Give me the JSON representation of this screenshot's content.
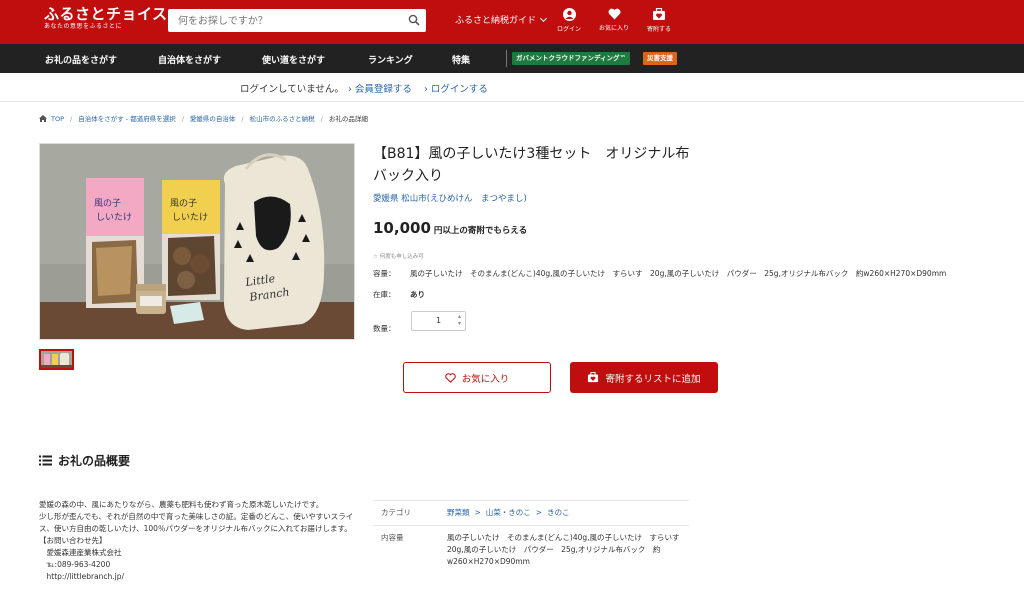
{
  "header": {
    "logo_main": "ふるさとチョイス",
    "logo_sub": "あなたの意思をふるさとに",
    "search_placeholder": "何をお探しですか？",
    "guide_label": "ふるさと納税ガイド",
    "icons": [
      {
        "icon": "user-icon",
        "label": "ログイン"
      },
      {
        "icon": "heart-icon",
        "label": "お気に入り"
      },
      {
        "icon": "donation-list-icon",
        "label": "寄附する"
      }
    ],
    "brand_color": "#c00d0d"
  },
  "nav": {
    "items": [
      "お礼の品をさがす",
      "自治体をさがす",
      "使い道をさがす",
      "ランキング",
      "特集"
    ],
    "badge_gcf": "ガバメントクラウドファンディング™",
    "badge_disaster": "災害支援",
    "badge_gcf_color": "#1e7a3e",
    "badge_disaster_color": "#e0631a"
  },
  "loginbar": {
    "message": "ログインしていません。",
    "register": "会員登録する",
    "login": "ログインする"
  },
  "breadcrumb": [
    "TOP",
    "自治体をさがす - 都道府県を選択",
    "愛媛県の自治体",
    "松山市のふるさと納税",
    "お礼の品詳細"
  ],
  "product": {
    "title": "【B81】風の子しいたけ3種セット　オリジナル布バック入り",
    "place": "愛媛県 松山市(えひめけん　まつやまし)",
    "price_number": "10,000",
    "price_unit": "円以上の寄附でもらえる",
    "anytime": "何度も申し込み可",
    "capacity_label": "容量：",
    "capacity_value": "風の子しいたけ　そのまんま(どんこ)40g,風の子しいたけ　すらいす　20g,風の子しいたけ　パウダー　25g,オリジナル布バック　約w260×H270×D90mm",
    "stock_label": "在庫：",
    "stock_value": "あり",
    "qty_label": "数量：",
    "qty_value": "1",
    "favorite_button": "お気に入り",
    "add_button": "寄附するリストに追加",
    "image_labels": {
      "bag_word": "Little Branch",
      "pack1": "風の子しいたけ",
      "pack2": "風の子しいたけ"
    }
  },
  "overview": {
    "heading": "お礼の品概要",
    "description": [
      "愛媛の森の中、風にあたりながら、農薬も肥料も使わず育った原木乾しいたけです。",
      "少し形が歪んでも、それが自然の中で育った美味しさの証。定番のどんこ、使いやすいスライス、使い方自由の乾しいたけ、100％パウダーをオリジナル布バックに入れてお届けします。",
      "【お問い合わせ先】",
      "　愛媛森連産業株式会社",
      "　℡:089-963-4200",
      "　http://littlebranch.jp/"
    ],
    "category_label": "カテゴリ",
    "category_path": [
      "野菜類",
      "山菜・きのこ",
      "きのこ"
    ],
    "content_label": "内容量",
    "content_value": "風の子しいたけ　そのまんま(どんこ)40g,風の子しいたけ　すらいす　20g,風の子しいたけ　パウダー　25g,オリジナル布バック　約w260×H270×D90mm"
  }
}
